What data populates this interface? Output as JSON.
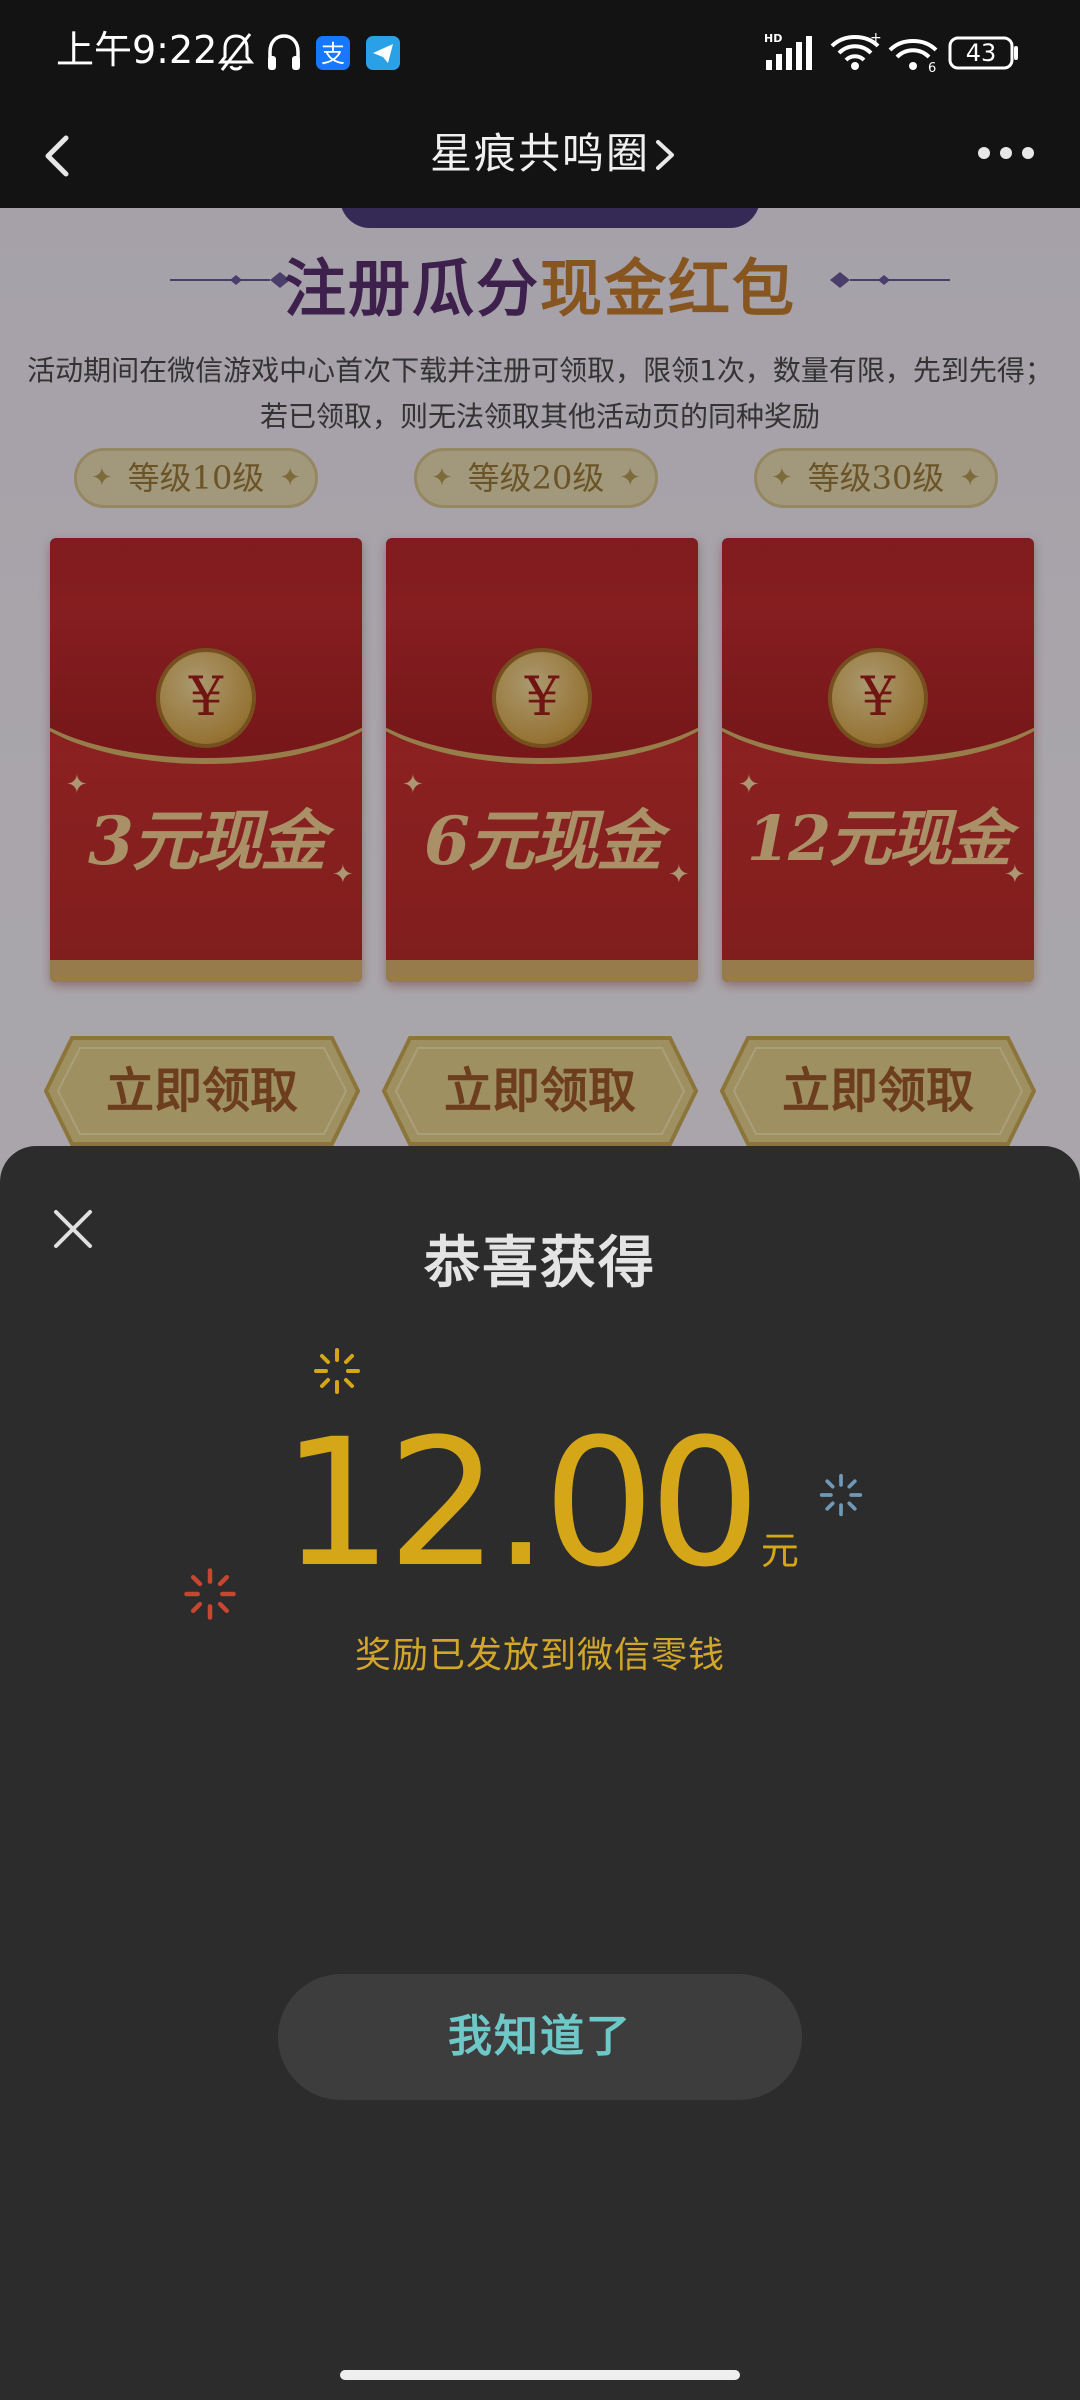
{
  "status_bar": {
    "time": "上午9:22",
    "battery": "43",
    "network_label": "HD"
  },
  "nav": {
    "title": "星痕共鸣圈"
  },
  "background": {
    "registration_title_part1": "注册瓜分",
    "registration_title_part2": "现金红包",
    "activity_description_line1": "活动期间在微信游戏中心首次下载并注册可领取，限领1次，数量有限，先到先得；",
    "activity_description_line2": "若已领取，则无法领取其他活动页的同种奖励",
    "rewards": [
      {
        "level": "等级10级",
        "amount": "3元现金",
        "button": "立即领取"
      },
      {
        "level": "等级20级",
        "amount": "6元现金",
        "button": "立即领取"
      },
      {
        "level": "等级30级",
        "amount": "12元现金",
        "button": "立即领取"
      }
    ]
  },
  "dialog": {
    "title": "恭喜获得",
    "amount": "12.00",
    "unit": "元",
    "note": "奖励已发放到微信零钱",
    "ack_button": "我知道了"
  },
  "colors": {
    "accent_gold": "#d5a718",
    "ack_text": "#6fc8c8",
    "sheet_background": "#2c2c2c",
    "envelope_red": "#c02c2f"
  },
  "icons": {
    "back": "chevron-left-icon",
    "title_chevron": "chevron-right-icon",
    "more": "more-dots-icon",
    "close": "close-icon",
    "coin": "yuan-coin-icon"
  }
}
